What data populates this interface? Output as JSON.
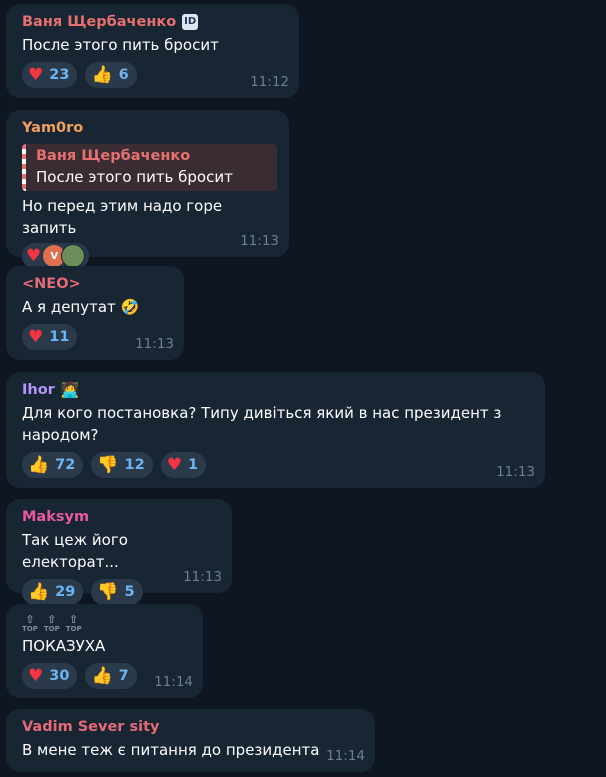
{
  "colors": {
    "background": "#0e1621",
    "bubble": "#182533",
    "reaction_bg": "#2b3a4a",
    "reaction_count": "#6cb4f2",
    "time": "#6d7f8f"
  },
  "messages": [
    {
      "author": "Ваня Щербаченко",
      "author_color": "#e5716f",
      "author_badge": "ID",
      "text": "После этого пить бросит",
      "reactions": [
        {
          "emoji": "♥",
          "icon": "heart-icon",
          "count": "23"
        },
        {
          "emoji": "👍",
          "icon": "thumbs-up-icon",
          "count": "6"
        }
      ],
      "time": "11:12"
    },
    {
      "author": "Yam0ro",
      "author_color": "#f0a05a",
      "reply": {
        "author": "Ваня Щербаченко",
        "text": "После этого пить бросит"
      },
      "text": "Но перед этим надо горе запить",
      "reactions": [
        {
          "emoji": "♥",
          "icon": "heart-icon",
          "avatars": [
            "V",
            ""
          ]
        }
      ],
      "time": "11:13"
    },
    {
      "author": "<NEO>",
      "author_color": "#e56a77",
      "text": "А я депутат 🤣",
      "reactions": [
        {
          "emoji": "♥",
          "icon": "heart-icon",
          "count": "11"
        }
      ],
      "time": "11:13"
    },
    {
      "author": "Ihor",
      "author_color": "#b694f9",
      "author_badge": "🧑‍💻",
      "text": "Для кого постановка? Типу дивіться який в нас президент з народом?",
      "reactions": [
        {
          "emoji": "👍",
          "icon": "thumbs-up-icon",
          "count": "72"
        },
        {
          "emoji": "👎",
          "icon": "thumbs-down-icon",
          "count": "12"
        },
        {
          "emoji": "♥",
          "icon": "heart-icon",
          "count": "1"
        }
      ],
      "time": "11:13"
    },
    {
      "author": "Maksym",
      "author_color": "#e85a9a",
      "text": "Так цеж його електорат...",
      "reactions": [
        {
          "emoji": "👍",
          "icon": "thumbs-up-icon",
          "count": "29"
        },
        {
          "emoji": "👎",
          "icon": "thumbs-down-icon",
          "count": "5"
        }
      ],
      "time": "11:13"
    },
    {
      "author_top_badges": [
        "TOP",
        "TOP",
        "TOP"
      ],
      "text": "ПОКАЗУХА",
      "reactions": [
        {
          "emoji": "♥",
          "icon": "heart-icon",
          "count": "30"
        },
        {
          "emoji": "👍",
          "icon": "thumbs-up-icon",
          "count": "7"
        }
      ],
      "time": "11:14"
    },
    {
      "author": "Vadim Sever sity",
      "author_color": "#e56a77",
      "text": "В мене теж є питання до президента",
      "time": "11:14"
    }
  ]
}
